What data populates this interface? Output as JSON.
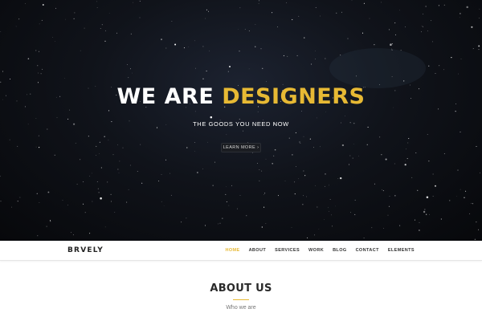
{
  "hero": {
    "headline_part1": "WE ARE",
    "headline_part2": "DESIGNERS",
    "subtitle": "THE GOODS YOU NEED NOW",
    "cta_label": "LEARN MORE",
    "cta_icon": "chevron-right-icon"
  },
  "navbar": {
    "logo": "BRVELY",
    "items": [
      {
        "label": "HOME",
        "active": true
      },
      {
        "label": "ABOUT",
        "active": false
      },
      {
        "label": "SERVICES",
        "active": false
      },
      {
        "label": "WORK",
        "active": false
      },
      {
        "label": "BLOG",
        "active": false
      },
      {
        "label": "CONTACT",
        "active": false
      },
      {
        "label": "ELEMENTS",
        "active": false
      }
    ]
  },
  "about": {
    "title": "ABOUT US",
    "subtitle": "Who we are"
  },
  "colors": {
    "accent": "#e7b934",
    "hero_background": "#0a0c10",
    "text_dark": "#2a2a2a"
  }
}
